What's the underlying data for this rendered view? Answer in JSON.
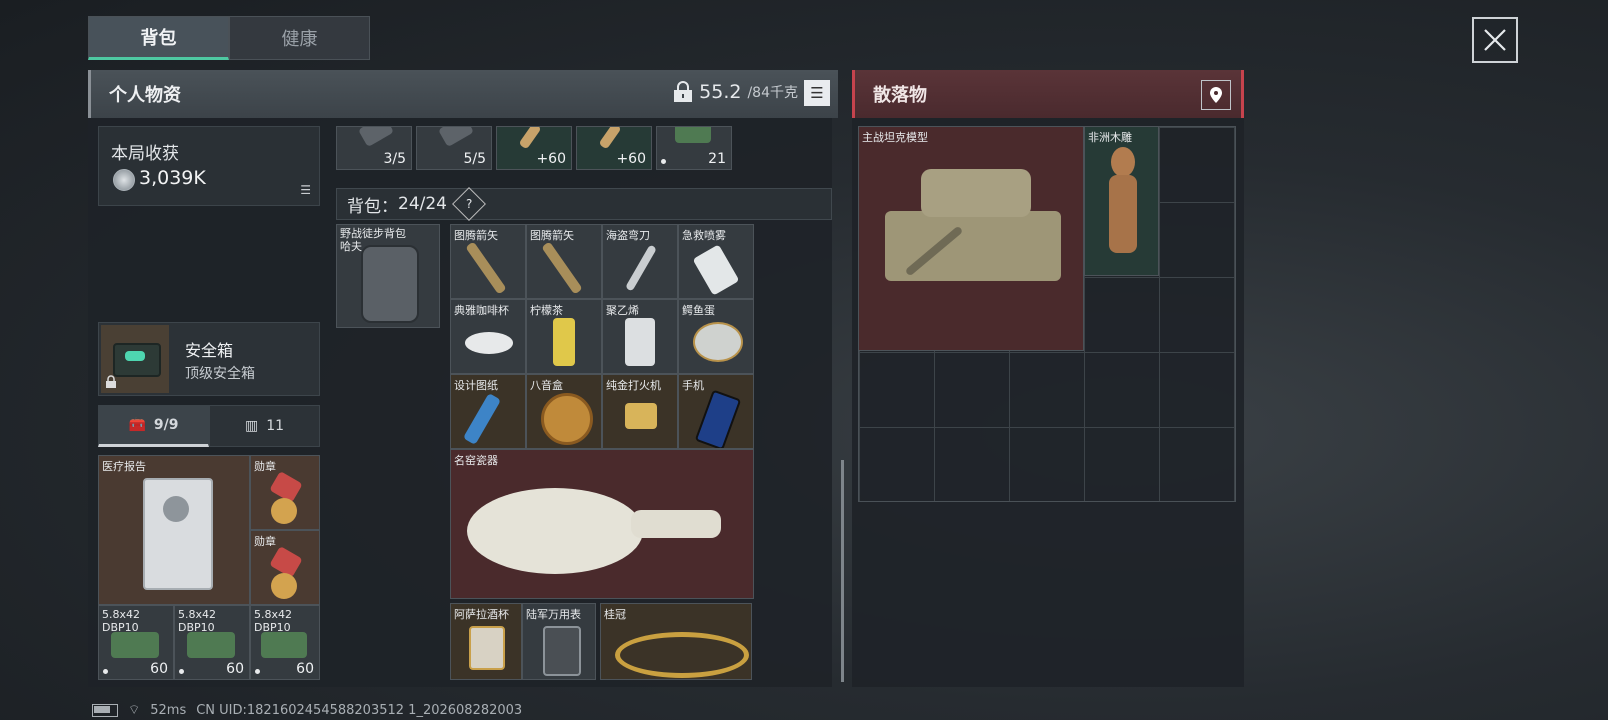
{
  "tabs": [
    {
      "label": "背包",
      "active": true
    },
    {
      "label": "健康",
      "active": false
    }
  ],
  "personal": {
    "title": "个人物资",
    "weight_current": "55.2",
    "weight_max": "/84千克"
  },
  "loot": {
    "title": "散落物"
  },
  "earnings": {
    "label": "本局收获",
    "value": "3,039K"
  },
  "safebox": {
    "title": "安全箱",
    "subtitle": "顶级安全箱"
  },
  "pouch_tabs": [
    {
      "label": "9/9",
      "active": true
    },
    {
      "label": "11",
      "active": false
    }
  ],
  "pouch_items": [
    {
      "name": "医疗报告"
    },
    {
      "name": "勋章"
    },
    {
      "name": "勋章"
    },
    {
      "name": "5.8x42 DBP10",
      "count": "60"
    },
    {
      "name": "5.8x42 DBP10",
      "count": "60"
    },
    {
      "name": "5.8x42 DBP10",
      "count": "60"
    }
  ],
  "top_row": [
    {
      "count": "3/5"
    },
    {
      "count": "5/5"
    },
    {
      "count": "+60"
    },
    {
      "count": "+60"
    },
    {
      "count": "21"
    }
  ],
  "backpack": {
    "label": "背包：",
    "capacity": "24/24",
    "help": "?",
    "equipped_name": "野战徒步背包 哈夫"
  },
  "backpack_items": [
    {
      "name": "图腾箭矢"
    },
    {
      "name": "图腾箭矢"
    },
    {
      "name": "海盗弯刀"
    },
    {
      "name": "急救喷雾"
    },
    {
      "name": "典雅咖啡杯"
    },
    {
      "name": "柠檬茶"
    },
    {
      "name": "聚乙烯"
    },
    {
      "name": "鳄鱼蛋"
    },
    {
      "name": "设计图纸"
    },
    {
      "name": "八音盒"
    },
    {
      "name": "纯金打火机"
    },
    {
      "name": "手机"
    },
    {
      "name": "名窑瓷器"
    },
    {
      "name": "阿萨拉酒杯"
    },
    {
      "name": "陆军万用表"
    },
    {
      "name": "桂冠"
    }
  ],
  "ground_items": [
    {
      "name": "主战坦克模型"
    },
    {
      "name": "非洲木雕"
    }
  ],
  "status": {
    "ping": "52ms",
    "uid": "CN UID:1821602454588203512 1_202608282003"
  },
  "colors": {
    "accent": "#4ec9a2",
    "loot_red": "#c6434d"
  }
}
